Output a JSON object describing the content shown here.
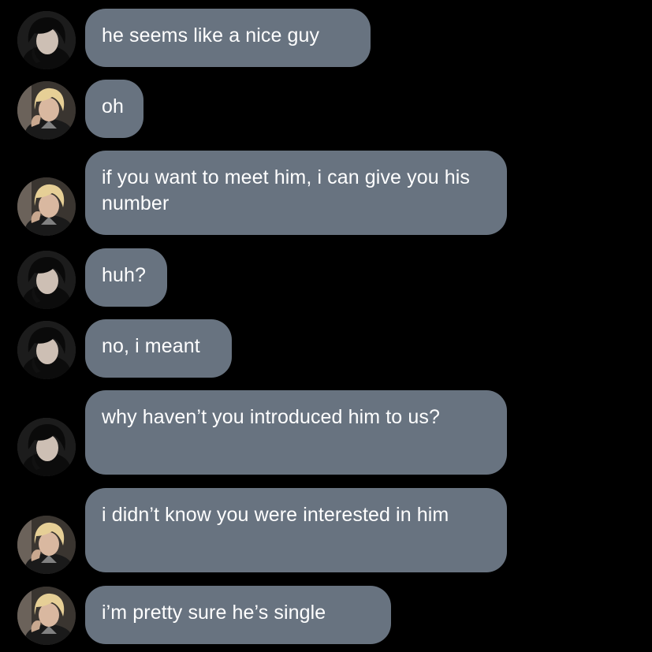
{
  "chat": {
    "colors": {
      "background": "#000000",
      "bubble": "#687380",
      "text": "#ffffff"
    },
    "messages": [
      {
        "sender": "dark-haired",
        "avatar_icon": "dark-haired-person-avatar-icon",
        "text": "he seems like a nice guy"
      },
      {
        "sender": "blonde",
        "avatar_icon": "blonde-person-avatar-icon",
        "text": "oh"
      },
      {
        "sender": "blonde",
        "avatar_icon": "blonde-person-avatar-icon",
        "text": "if you want to meet him, i can give you his number"
      },
      {
        "sender": "dark-haired",
        "avatar_icon": "dark-haired-person-avatar-icon",
        "text": "huh?"
      },
      {
        "sender": "dark-haired",
        "avatar_icon": "dark-haired-person-avatar-icon",
        "text": "no, i meant"
      },
      {
        "sender": "dark-haired",
        "avatar_icon": "dark-haired-person-avatar-icon",
        "text": "why haven’t you introduced him to us?"
      },
      {
        "sender": "blonde",
        "avatar_icon": "blonde-person-avatar-icon",
        "text": "i didn’t know you were interested in him"
      },
      {
        "sender": "blonde",
        "avatar_icon": "blonde-person-avatar-icon",
        "text": "i’m pretty sure he’s single"
      }
    ]
  }
}
